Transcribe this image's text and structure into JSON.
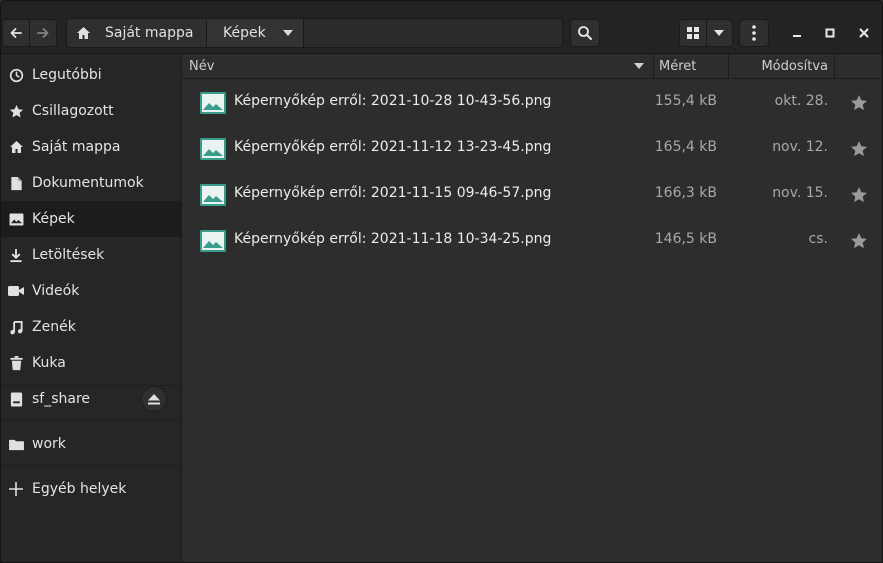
{
  "header": {
    "breadcrumb": {
      "home_label": "Saját mappa",
      "current_label": "Képek"
    }
  },
  "sidebar": {
    "items": [
      {
        "label": "Legutóbbi",
        "icon": "clock-icon"
      },
      {
        "label": "Csillagozott",
        "icon": "star-icon"
      },
      {
        "label": "Saját mappa",
        "icon": "home-icon"
      },
      {
        "label": "Dokumentumok",
        "icon": "document-icon"
      },
      {
        "label": "Képek",
        "icon": "image-icon",
        "active": true
      },
      {
        "label": "Letöltések",
        "icon": "download-icon"
      },
      {
        "label": "Videók",
        "icon": "video-icon"
      },
      {
        "label": "Zenék",
        "icon": "music-icon"
      },
      {
        "label": "Kuka",
        "icon": "trash-icon"
      }
    ],
    "devices": [
      {
        "label": "sf_share",
        "icon": "drive-icon",
        "eject": true
      }
    ],
    "bookmarks": [
      {
        "label": "work",
        "icon": "folder-icon"
      }
    ],
    "other": {
      "label": "Egyéb helyek",
      "icon": "plus-icon"
    }
  },
  "columns": {
    "name": "Név",
    "size": "Méret",
    "modified": "Módosítva"
  },
  "files": [
    {
      "name": "Képernyőkép erről: 2021-10-28 10-43-56.png",
      "size": "155,4 kB",
      "modified": "okt. 28."
    },
    {
      "name": "Képernyőkép erről: 2021-11-12 13-23-45.png",
      "size": "165,4 kB",
      "modified": "nov. 12."
    },
    {
      "name": "Képernyőkép erről: 2021-11-15 09-46-57.png",
      "size": "166,3 kB",
      "modified": "nov. 15."
    },
    {
      "name": "Képernyőkép erről: 2021-11-18 10-34-25.png",
      "size": "146,5 kB",
      "modified": "cs."
    }
  ],
  "colors": {
    "file_icon": "#3a9c8a",
    "star": "#9a9a9a"
  }
}
